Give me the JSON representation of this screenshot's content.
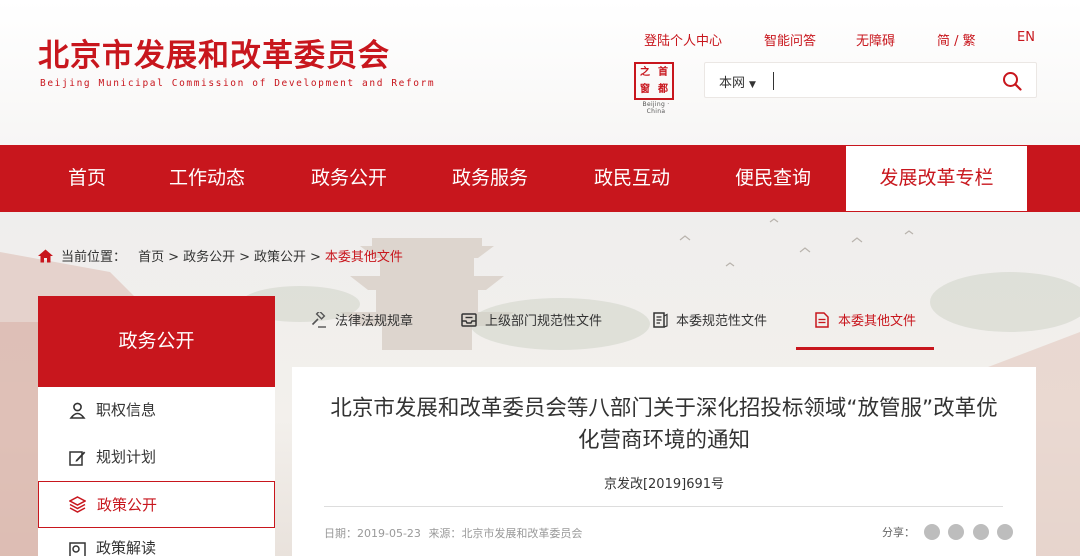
{
  "header": {
    "site_title": "北京市发展和改革委员会",
    "site_subtitle": "Beijing Municipal Commission of Development and Reform",
    "links": [
      "登陆个人中心",
      "智能问答",
      "无障碍",
      "简 / 繁",
      "EN"
    ],
    "seal": {
      "chars": [
        "首",
        "都",
        "之",
        "窗"
      ],
      "caption": "Beijing · China"
    },
    "search": {
      "scope": "本网",
      "placeholder": ""
    }
  },
  "nav": {
    "items": [
      "首页",
      "工作动态",
      "政务公开",
      "政务服务",
      "政民互动",
      "便民查询",
      "发展改革专栏"
    ],
    "active_index": 6
  },
  "breadcrumb": {
    "label": "当前位置：",
    "items": [
      "首页",
      "政务公开",
      "政策公开"
    ],
    "current": "本委其他文件",
    "separator": ">"
  },
  "sidebar": {
    "title": "政务公开",
    "items": [
      {
        "label": "职权信息",
        "icon": "person-icon"
      },
      {
        "label": "规划计划",
        "icon": "edit-icon"
      },
      {
        "label": "政策公开",
        "icon": "layers-icon",
        "active": true
      },
      {
        "label": "政策解读",
        "icon": "interpret-icon"
      }
    ]
  },
  "tabs": {
    "items": [
      {
        "label": "法律法规规章",
        "icon": "gavel-icon"
      },
      {
        "label": "上级部门规范性文件",
        "icon": "inbox-icon"
      },
      {
        "label": "本委规范性文件",
        "icon": "document-icon"
      },
      {
        "label": "本委其他文件",
        "icon": "file-icon",
        "active": true
      }
    ]
  },
  "article": {
    "title": "北京市发展和改革委员会等八部门关于深化招投标领域“放管服”改革优化营商环境的通知",
    "doc_number": "京发改[2019]691号",
    "date_label": "日期：",
    "date": "2019-05-23",
    "source_label": "来源：",
    "source": "北京市发展和改革委员会",
    "share_label": "分享："
  },
  "colors": {
    "brand_red": "#c8161d",
    "nav_text": "#ffffff"
  }
}
